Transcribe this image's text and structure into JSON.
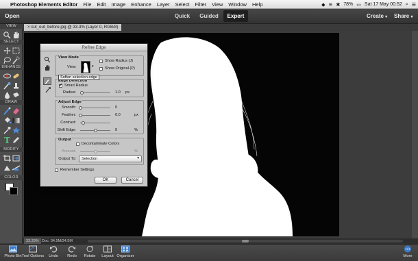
{
  "menubar": {
    "app_name": "Photoshop Elements Editor",
    "items": [
      "File",
      "Edit",
      "Image",
      "Enhance",
      "Layer",
      "Select",
      "Filter",
      "View",
      "Window",
      "Help"
    ],
    "battery": "78%",
    "datetime": "Sat 17 May 00:52"
  },
  "topbar": {
    "open_label": "Open",
    "modes": [
      "Quick",
      "Guided",
      "Expert"
    ],
    "active_mode": "Expert",
    "create_label": "Create",
    "share_label": "Share"
  },
  "toolpanel": {
    "sections": [
      "VIEW",
      "SELECT",
      "ENHANCE",
      "DRAW",
      "MODIFY",
      "COLOR"
    ]
  },
  "document": {
    "tab_title": "cut_out_before.jpg @ 33.3% (Layer 0, RGB/8)",
    "zoom": "33.33%",
    "doc_size": "Doc: 34.5M/34.5M"
  },
  "dialog": {
    "title": "Refine Edge",
    "view_mode": {
      "heading": "View Mode",
      "view_label": "View:",
      "show_radius": "Show Radius (J)",
      "show_original": "Show Original (P)"
    },
    "edge_detection": {
      "heading": "Edge Detection",
      "smart_radius": "Smart Radius",
      "smart_radius_checked": true,
      "radius_label": "Radius:",
      "radius_value": "1.0",
      "radius_unit": "px"
    },
    "adjust_edge": {
      "heading": "Adjust Edge",
      "smooth_label": "Smooth:",
      "smooth_value": "0",
      "feather_label": "Feather:",
      "feather_value": "0.0",
      "feather_unit": "px",
      "contrast_label": "Contrast:",
      "shift_label": "Shift Edge:",
      "shift_value": "0",
      "shift_unit": "%",
      "tooltip": "Soften selection edge"
    },
    "output": {
      "heading": "Output",
      "decontaminate": "Decontaminate Colors",
      "amount_label": "Amount:",
      "amount_unit": "%",
      "output_to_label": "Output To:",
      "output_to_value": "Selection"
    },
    "remember": "Remember Settings",
    "ok": "OK",
    "cancel": "Cancel"
  },
  "bottombar": {
    "items": [
      "Photo Bin",
      "Tool Options",
      "Undo",
      "Redo",
      "Rotate",
      "Layout",
      "Organizer"
    ],
    "more": "More"
  },
  "colors": {
    "ui_dark": "#3a3a3a",
    "dialog_bg": "#c6c6c6",
    "accent_blue": "#3d7cc9"
  }
}
